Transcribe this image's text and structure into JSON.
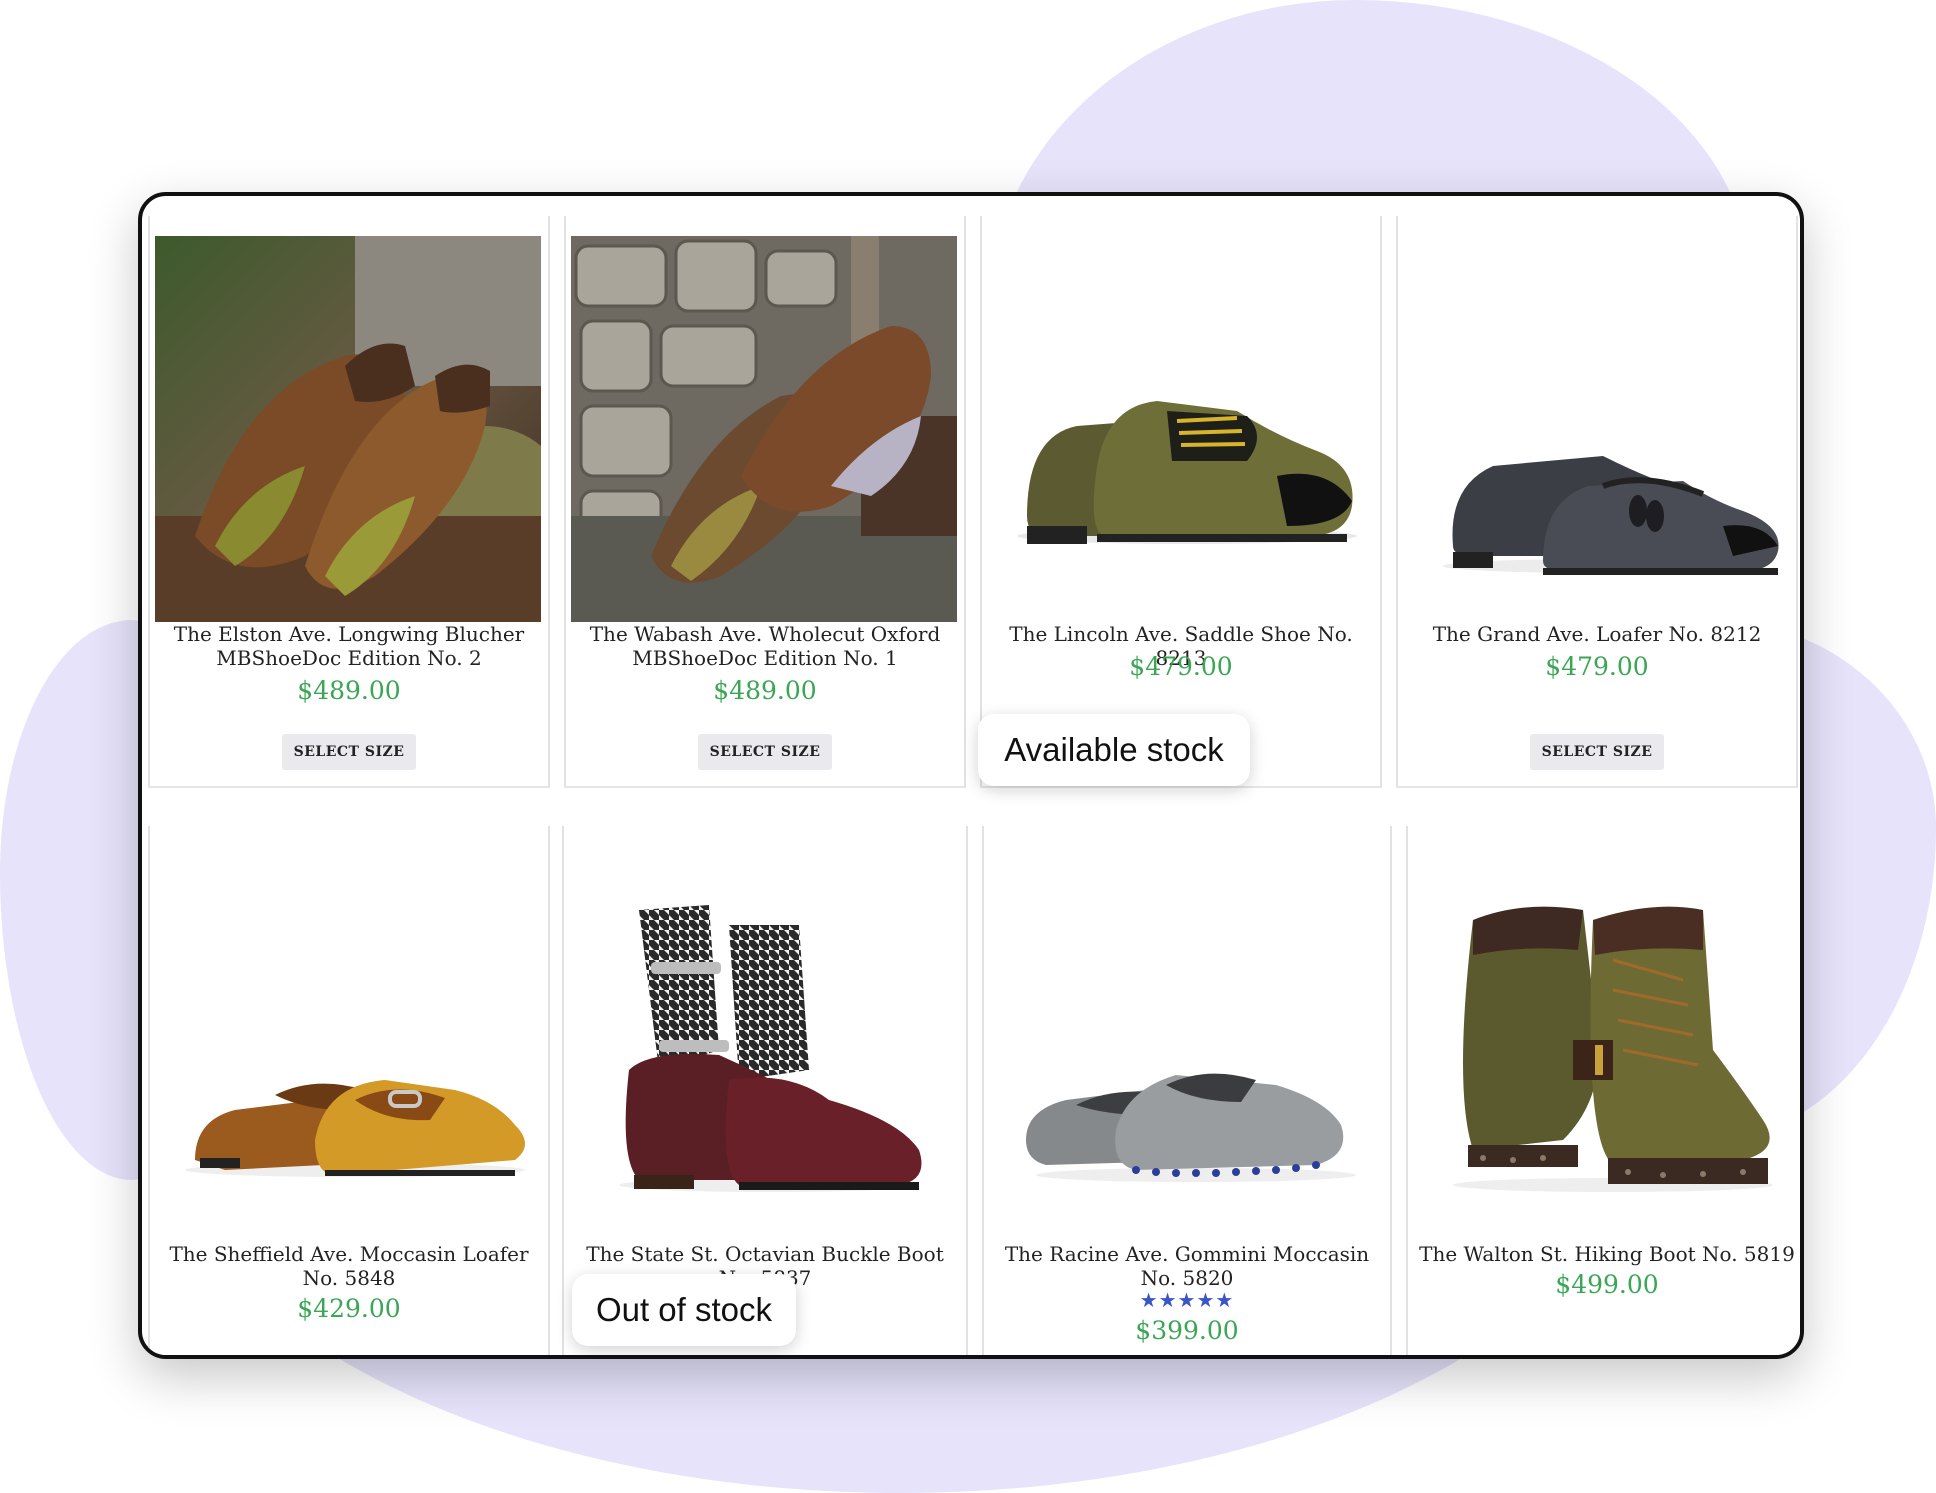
{
  "products": [
    {
      "title": "The Elston Ave. Longwing Blucher MBShoeDoc Edition No. 2",
      "price": "$489.00",
      "button": "SELECT SIZE",
      "image": "brown-green-longwing-brogue-on-rock-photo"
    },
    {
      "title": "The Wabash Ave. Wholecut Oxford MBShoeDoc Edition No. 1",
      "price": "$489.00",
      "button": "SELECT SIZE",
      "image": "patina-wholecut-oxford-on-stone-photo"
    },
    {
      "title": "The Lincoln Ave. Saddle Shoe No. 8213",
      "price": "$479.00",
      "image": "olive-black-saddle-shoe-photo"
    },
    {
      "title": "The Grand Ave. Loafer No. 8212",
      "price": "$479.00",
      "button": "SELECT SIZE",
      "image": "grey-tassel-loafer-photo"
    },
    {
      "title": "The Sheffield Ave. Moccasin Loafer No. 5848",
      "price": "$429.00",
      "image": "tan-horsebit-moccasin-photo"
    },
    {
      "title": "The State St. Octavian Buckle Boot No. 5837",
      "price": "",
      "image": "houndstooth-buckle-boot-photo"
    },
    {
      "title": "The Racine Ave. Gommini Moccasin No. 5820",
      "price": "$399.00",
      "rating": "★★★★★",
      "image": "grey-driving-moccasin-photo"
    },
    {
      "title": "The Walton St. Hiking Boot No. 5819",
      "price": "$499.00",
      "image": "patina-hiking-boot-photo"
    }
  ],
  "callouts": {
    "available": "Available stock",
    "out": "Out of stock"
  },
  "colors": {
    "price": "#3ba656",
    "blob": "#e6e3fb",
    "stars": "#3a55c8"
  }
}
